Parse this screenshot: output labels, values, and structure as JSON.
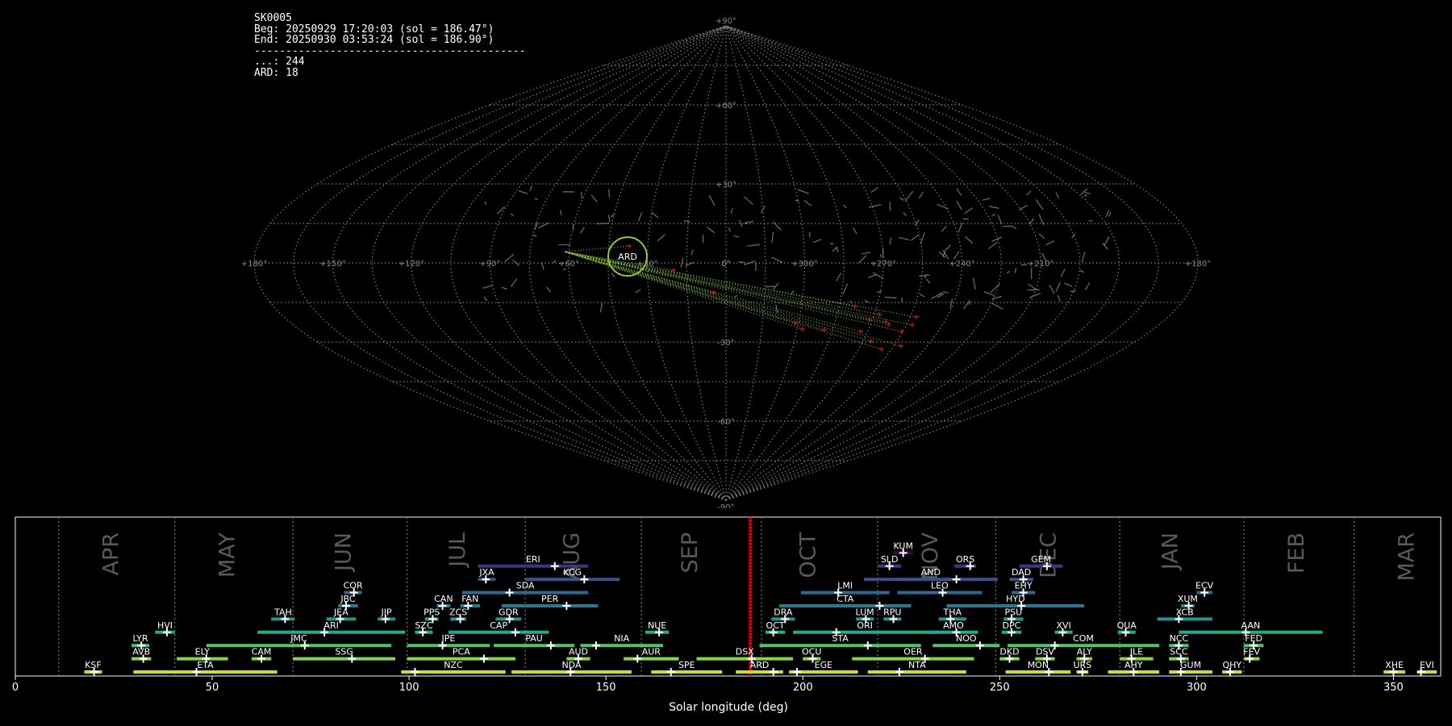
{
  "info": {
    "station": "SK0005",
    "begin": "Beg: 20250929 17:20:03 (sol = 186.47°)",
    "end": "End: 20250930 03:53:24 (sol = 186.90°)",
    "separator": "-------------------------------------------",
    "count_sporadic": "...: 244",
    "count_ard": "ARD: 18"
  },
  "sky_map": {
    "projection": "sinusoidal",
    "lon_labels": [
      "+180°",
      "+150°",
      "+120°",
      "+90°",
      "+60°",
      "+30°",
      "0°",
      "+300°",
      "+270°",
      "+240°",
      "+210°",
      "+180°"
    ],
    "lat_labels": [
      "+90°",
      "+60°",
      "+30°",
      "0°",
      "-30°",
      "-60°",
      "-90°"
    ],
    "grid_color": "#7f7f7f",
    "trail_color": "#8fc63f",
    "meteor_color": "#ff2020",
    "highlight_shower": "ARD",
    "highlight_color": "#8fc63f"
  },
  "chart_data": {
    "type": "timeline",
    "xlabel": "Solar longitude (deg)",
    "xlim": [
      0,
      362
    ],
    "xticks": [
      0,
      50,
      100,
      150,
      200,
      250,
      300,
      350
    ],
    "current_sol": [
      186.47,
      186.9
    ],
    "current_color": "#ff0000",
    "months": [
      {
        "label": "APR",
        "x": 24.5
      },
      {
        "label": "MAY",
        "x": 54.0
      },
      {
        "label": "JUN",
        "x": 83.5
      },
      {
        "label": "JUL",
        "x": 112.5
      },
      {
        "label": "AUG",
        "x": 141.5
      },
      {
        "label": "SEP",
        "x": 171.5
      },
      {
        "label": "OCT",
        "x": 201.5
      },
      {
        "label": "NOV",
        "x": 232.5
      },
      {
        "label": "DEC",
        "x": 262.5
      },
      {
        "label": "JAN",
        "x": 293.5
      },
      {
        "label": "FEB",
        "x": 325.5
      },
      {
        "label": "MAR",
        "x": 353.5
      }
    ],
    "month_lines": [
      11,
      40.5,
      70.5,
      99.5,
      129.5,
      159,
      189.5,
      219,
      249,
      280.5,
      312,
      340
    ],
    "showers": [
      {
        "code": "KSF",
        "start": 17.5,
        "end": 22,
        "peak": 20,
        "row": 0
      },
      {
        "code": "ETA",
        "start": 30,
        "end": 66.5,
        "peak": 46,
        "row": 0
      },
      {
        "code": "NZC",
        "start": 98,
        "end": 124.5,
        "peak": 101.5,
        "row": 0
      },
      {
        "code": "NDA",
        "start": 126,
        "end": 156.5,
        "peak": 141,
        "row": 0
      },
      {
        "code": "SPE",
        "start": 161.5,
        "end": 179.5,
        "peak": 166.5,
        "row": 0
      },
      {
        "code": "ARD",
        "start": 183,
        "end": 195,
        "peak": 192.5,
        "row": 0
      },
      {
        "code": "EGE",
        "start": 196.5,
        "end": 214,
        "peak": 198.5,
        "row": 0
      },
      {
        "code": "NTA",
        "start": 216.5,
        "end": 241.5,
        "peak": 224.5,
        "row": 0
      },
      {
        "code": "MON",
        "start": 251.5,
        "end": 268,
        "peak": 262.5,
        "row": 0
      },
      {
        "code": "URS",
        "start": 269.5,
        "end": 272.5,
        "peak": 271,
        "row": 0
      },
      {
        "code": "AHY",
        "start": 277.5,
        "end": 290.5,
        "peak": 284,
        "row": 0
      },
      {
        "code": "GUM",
        "start": 293,
        "end": 304,
        "peak": 296,
        "row": 0
      },
      {
        "code": "QHY",
        "start": 306.5,
        "end": 311.5,
        "peak": 308.5,
        "row": 0
      },
      {
        "code": "XHE",
        "start": 347.5,
        "end": 353,
        "peak": 350,
        "row": 0
      },
      {
        "code": "EVI",
        "start": 356,
        "end": 361,
        "peak": 357,
        "row": 0
      },
      {
        "code": "AVB",
        "start": 29.5,
        "end": 34.5,
        "peak": 32.5,
        "row": 1
      },
      {
        "code": "ELY",
        "start": 41,
        "end": 54,
        "peak": 48.5,
        "row": 1
      },
      {
        "code": "CAM",
        "start": 60,
        "end": 65,
        "peak": 62.5,
        "row": 1
      },
      {
        "code": "SSG",
        "start": 70.5,
        "end": 96.5,
        "peak": 85.5,
        "row": 1
      },
      {
        "code": "PCA",
        "start": 99.5,
        "end": 127,
        "peak": 119,
        "row": 1
      },
      {
        "code": "AUD",
        "start": 140,
        "end": 146,
        "peak": 143,
        "row": 1
      },
      {
        "code": "AUR",
        "start": 154.5,
        "end": 168.5,
        "peak": 158,
        "row": 1
      },
      {
        "code": "DSX",
        "start": 173,
        "end": 197.5,
        "peak": 187,
        "row": 1
      },
      {
        "code": "OCU",
        "start": 200,
        "end": 204.5,
        "peak": 202.5,
        "row": 1
      },
      {
        "code": "OER",
        "start": 212.5,
        "end": 243.5,
        "peak": 231,
        "row": 1
      },
      {
        "code": "DKD",
        "start": 250,
        "end": 255,
        "peak": 252.5,
        "row": 1
      },
      {
        "code": "DSV",
        "start": 259,
        "end": 264,
        "peak": 262,
        "row": 1
      },
      {
        "code": "ALY",
        "start": 269.5,
        "end": 273.5,
        "peak": 271.5,
        "row": 1
      },
      {
        "code": "JLE",
        "start": 280.5,
        "end": 289,
        "peak": 283.5,
        "row": 1
      },
      {
        "code": "SCC",
        "start": 293,
        "end": 298,
        "peak": 296,
        "row": 1
      },
      {
        "code": "FEV",
        "start": 312,
        "end": 316,
        "peak": 313.5,
        "row": 1
      },
      {
        "code": "LYR",
        "start": 29.5,
        "end": 34,
        "peak": 32,
        "row": 2
      },
      {
        "code": "JMC",
        "start": 48.5,
        "end": 95.5,
        "peak": 73.5,
        "row": 2
      },
      {
        "code": "JPE",
        "start": 99.5,
        "end": 120.5,
        "peak": 108.5,
        "row": 2
      },
      {
        "code": "PAU",
        "start": 121.5,
        "end": 142,
        "peak": 136,
        "row": 2
      },
      {
        "code": "NIA",
        "start": 143.5,
        "end": 164.5,
        "peak": 147.5,
        "row": 2
      },
      {
        "code": "STA",
        "start": 189,
        "end": 230,
        "peak": 216.5,
        "row": 2
      },
      {
        "code": "NOO",
        "start": 233,
        "end": 250,
        "peak": 245,
        "row": 2
      },
      {
        "code": "COM",
        "start": 252,
        "end": 290.5,
        "peak": 264,
        "row": 2
      },
      {
        "code": "NCC",
        "start": 293,
        "end": 298,
        "peak": 295.5,
        "row": 2
      },
      {
        "code": "FED",
        "start": 312,
        "end": 317,
        "peak": 314.5,
        "row": 2
      },
      {
        "code": "HVI",
        "start": 35.5,
        "end": 40.5,
        "peak": 38.5,
        "row": 3
      },
      {
        "code": "ARI",
        "start": 61.5,
        "end": 99,
        "peak": 78.5,
        "row": 3
      },
      {
        "code": "SZC",
        "start": 101.5,
        "end": 106,
        "peak": 103.5,
        "row": 3
      },
      {
        "code": "CAP",
        "start": 110,
        "end": 135.5,
        "peak": 127,
        "row": 3
      },
      {
        "code": "NUE",
        "start": 160,
        "end": 166,
        "peak": 163.5,
        "row": 3
      },
      {
        "code": "OCT",
        "start": 190.5,
        "end": 195.5,
        "peak": 192.5,
        "row": 3
      },
      {
        "code": "ORI",
        "start": 197.5,
        "end": 234,
        "peak": 208.5,
        "row": 3
      },
      {
        "code": "AMO",
        "start": 232,
        "end": 244.5,
        "peak": 239,
        "row": 3
      },
      {
        "code": "DPC",
        "start": 250.5,
        "end": 255.5,
        "peak": 253,
        "row": 3
      },
      {
        "code": "XVI",
        "start": 264,
        "end": 268.5,
        "peak": 266,
        "row": 3
      },
      {
        "code": "QUA",
        "start": 280,
        "end": 284.5,
        "peak": 282,
        "row": 3
      },
      {
        "code": "AAN",
        "start": 295.5,
        "end": 332,
        "peak": 312.5,
        "row": 3
      },
      {
        "code": "TAH",
        "start": 65,
        "end": 71,
        "peak": 68.5,
        "row": 4
      },
      {
        "code": "JEA",
        "start": 79,
        "end": 86.5,
        "peak": 82.5,
        "row": 4
      },
      {
        "code": "JIP",
        "start": 92,
        "end": 96.5,
        "peak": 94,
        "row": 4
      },
      {
        "code": "PPS",
        "start": 104,
        "end": 107.5,
        "peak": 106,
        "row": 4
      },
      {
        "code": "ZCS",
        "start": 110.5,
        "end": 114.5,
        "peak": 113,
        "row": 4
      },
      {
        "code": "GDR",
        "start": 122,
        "end": 128.5,
        "peak": 125.5,
        "row": 4
      },
      {
        "code": "DRA",
        "start": 192,
        "end": 198,
        "peak": 195.5,
        "row": 4
      },
      {
        "code": "LUM",
        "start": 213.5,
        "end": 218,
        "peak": 216,
        "row": 4
      },
      {
        "code": "RPU",
        "start": 220.5,
        "end": 225,
        "peak": 223,
        "row": 4
      },
      {
        "code": "THA",
        "start": 234.5,
        "end": 241.5,
        "peak": 237.5,
        "row": 4
      },
      {
        "code": "PSU",
        "start": 251,
        "end": 256,
        "peak": 253,
        "row": 4
      },
      {
        "code": "XCB",
        "start": 290,
        "end": 304,
        "peak": 295.5,
        "row": 4
      },
      {
        "code": "JBC",
        "start": 82,
        "end": 87,
        "peak": 84,
        "row": 5
      },
      {
        "code": "CAN",
        "start": 107,
        "end": 110.5,
        "peak": 108.5,
        "row": 5
      },
      {
        "code": "FAN",
        "start": 113,
        "end": 118,
        "peak": 115,
        "row": 5
      },
      {
        "code": "PER",
        "start": 123.5,
        "end": 148,
        "peak": 140,
        "row": 5
      },
      {
        "code": "CTA",
        "start": 194,
        "end": 227.5,
        "peak": 219.5,
        "row": 5
      },
      {
        "code": "HYD",
        "start": 236.5,
        "end": 271.5,
        "peak": 255.5,
        "row": 5
      },
      {
        "code": "XUM",
        "start": 296,
        "end": 299.5,
        "peak": 298,
        "row": 5
      },
      {
        "code": "COR",
        "start": 83.5,
        "end": 88,
        "peak": 86,
        "row": 6
      },
      {
        "code": "SDA",
        "start": 113.5,
        "end": 145.5,
        "peak": 125.5,
        "row": 6
      },
      {
        "code": "LMI",
        "start": 199.5,
        "end": 222,
        "peak": 209,
        "row": 6
      },
      {
        "code": "LEO",
        "start": 224,
        "end": 245.5,
        "peak": 235.5,
        "row": 6
      },
      {
        "code": "EHY",
        "start": 253,
        "end": 259,
        "peak": 256,
        "row": 6
      },
      {
        "code": "ECV",
        "start": 300,
        "end": 304,
        "peak": 302,
        "row": 6
      },
      {
        "code": "JXA",
        "start": 117.5,
        "end": 122,
        "peak": 119.5,
        "row": 7
      },
      {
        "code": "KCG",
        "start": 129.5,
        "end": 153.5,
        "peak": 144.5,
        "row": 7
      },
      {
        "code": "AND",
        "start": 215.5,
        "end": 249.5,
        "peak": 239,
        "row": 7
      },
      {
        "code": "DAD",
        "start": 252.5,
        "end": 258.5,
        "peak": 256,
        "row": 7
      },
      {
        "code": "ERI",
        "start": 117.5,
        "end": 145.5,
        "peak": 137,
        "row": 8
      },
      {
        "code": "SLD",
        "start": 219,
        "end": 225,
        "peak": 222,
        "row": 8
      },
      {
        "code": "ORS",
        "start": 238.5,
        "end": 244,
        "peak": 242.5,
        "row": 8
      },
      {
        "code": "GEM",
        "start": 255,
        "end": 266,
        "peak": 262,
        "row": 8
      },
      {
        "code": "KUM",
        "start": 223,
        "end": 228,
        "peak": 225.5,
        "row": 9
      }
    ]
  }
}
